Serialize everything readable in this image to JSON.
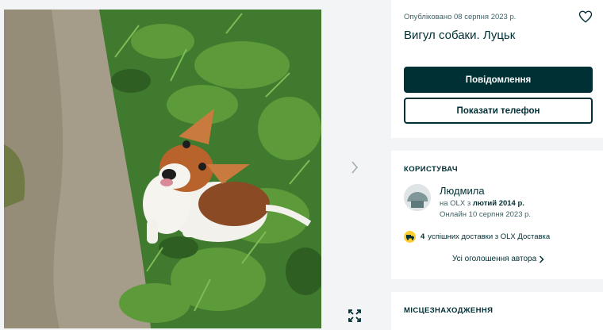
{
  "gallery": {
    "photo_alt": "dog",
    "next_icon": "chevron-right-icon",
    "expand_icon": "expand-icon"
  },
  "ad": {
    "published": "Опубліковано 08 серпня 2023 р.",
    "title": "Вигул собаки. Луцьк",
    "message_button": "Повідомлення",
    "phone_button": "Показати телефон",
    "favorite_icon": "heart-icon"
  },
  "user": {
    "section_title": "КОРИСТУВАЧ",
    "name": "Людмила",
    "since_prefix": "на OLX з",
    "since_date": "лютий 2014 р.",
    "online": "Онлайн 10 серпня 2023 р.",
    "delivery_count": "4",
    "delivery_text": "успішних доставки з OLX Доставка",
    "all_ads": "Усі оголошення автора"
  },
  "location": {
    "section_title": "МІСЦЕЗНАХОДЖЕННЯ"
  },
  "colors": {
    "primary": "#002f34",
    "muted": "#406367",
    "background": "#f2f4f5",
    "delivery_badge": "#ffce32"
  }
}
